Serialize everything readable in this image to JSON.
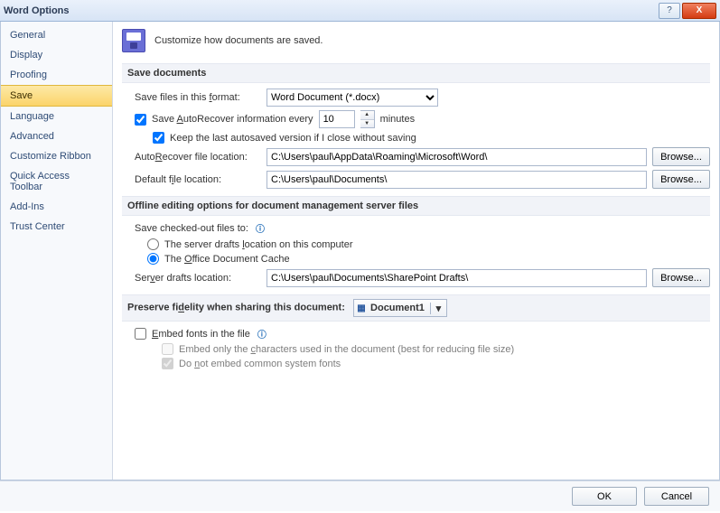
{
  "window": {
    "title": "Word Options"
  },
  "sidebar": {
    "items": [
      {
        "label": "General"
      },
      {
        "label": "Display"
      },
      {
        "label": "Proofing"
      },
      {
        "label": "Save"
      },
      {
        "label": "Language"
      },
      {
        "label": "Advanced"
      },
      {
        "label": "Customize Ribbon"
      },
      {
        "label": "Quick Access Toolbar"
      },
      {
        "label": "Add-Ins"
      },
      {
        "label": "Trust Center"
      }
    ],
    "selected_index": 3
  },
  "intro": "Customize how documents are saved.",
  "save_documents": {
    "heading": "Save documents",
    "format_label_pre": "Save files in this ",
    "format_label_ul": "f",
    "format_label_post": "ormat:",
    "format_value": "Word Document (*.docx)",
    "autorecover_pre": "Save ",
    "autorecover_ul": "A",
    "autorecover_post": "utoRecover information every",
    "autorecover_minutes": "10",
    "minutes_label": "minutes",
    "keep_last_label": "Keep the last autosaved version if I close without saving",
    "ar_loc_label_pre": "Auto",
    "ar_loc_label_ul": "R",
    "ar_loc_label_post": "ecover file location:",
    "ar_loc_value": "C:\\Users\\paul\\AppData\\Roaming\\Microsoft\\Word\\",
    "def_loc_label_pre": "Default f",
    "def_loc_label_ul": "i",
    "def_loc_label_post": "le location:",
    "def_loc_value": "C:\\Users\\paul\\Documents\\",
    "browse_label": "Browse..."
  },
  "offline": {
    "heading": "Offline editing options for document management server files",
    "save_to_label": "Save checked-out files to:",
    "opt_server_pre": "The server drafts ",
    "opt_server_ul": "l",
    "opt_server_post": "ocation on this computer",
    "opt_cache_pre": "The ",
    "opt_cache_ul": "O",
    "opt_cache_post": "ffice Document Cache",
    "drafts_label_pre": "Ser",
    "drafts_label_ul": "v",
    "drafts_label_post": "er drafts location:",
    "drafts_value": "C:\\Users\\paul\\Documents\\SharePoint Drafts\\",
    "browse_label": "Browse..."
  },
  "fidelity": {
    "heading_pre": "Preserve fi",
    "heading_ul": "d",
    "heading_post": "elity when sharing this document:",
    "doc_name": "Document1",
    "embed_label_pre": "",
    "embed_label_ul": "E",
    "embed_label_post": "mbed fonts in the file",
    "sub1_pre": "Embed only the ",
    "sub1_ul": "c",
    "sub1_post": "haracters used in the document (best for reducing file size)",
    "sub2_pre": "Do ",
    "sub2_ul": "n",
    "sub2_post": "ot embed common system fonts"
  },
  "footer": {
    "ok": "OK",
    "cancel": "Cancel"
  }
}
